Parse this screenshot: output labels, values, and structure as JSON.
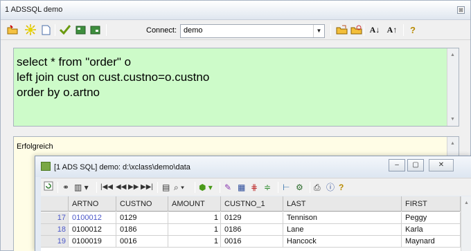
{
  "window": {
    "title": "1 ADSSQL demo",
    "close_glyph": "⊠"
  },
  "toolbar": {
    "icons": [
      "open-folder-icon",
      "execute-star-icon",
      "new-document-icon",
      "commit-check-icon",
      "grid-view-icon",
      "grid-view-2-icon"
    ],
    "connect_label": "Connect:",
    "connection_value": "demo",
    "right_icons": [
      "open-file-icon",
      "save-file-icon",
      "sort-ascending-icon",
      "sort-descending-icon",
      "help-icon"
    ],
    "sort_asc_label": "A↓",
    "sort_desc_label": "A↑"
  },
  "sql": {
    "lines": [
      "select * from \"order\" o",
      "left join cust on cust.custno=o.custno",
      "order by o.artno"
    ]
  },
  "message": {
    "text": "Erfolgreich"
  },
  "result_window": {
    "title": "[1 ADS SQL] demo: d:\\xclass\\demo\\data",
    "minimize_glyph": "–",
    "maximize_glyph": "▢",
    "close_glyph": "✕"
  },
  "grid": {
    "columns": [
      "ARTNO",
      "CUSTNO",
      "AMOUNT",
      "CUSTNO_1",
      "LAST",
      "FIRST"
    ],
    "rows": [
      {
        "num": "17",
        "artno": "0100012",
        "custno": "0129",
        "amount": "1",
        "custno_1": "0129",
        "last": "Tennison",
        "first": "Peggy"
      },
      {
        "num": "18",
        "artno": "0100012",
        "custno": "0186",
        "amount": "1",
        "custno_1": "0186",
        "last": "Lane",
        "first": "Karla"
      },
      {
        "num": "19",
        "artno": "0100019",
        "custno": "0016",
        "amount": "1",
        "custno_1": "0016",
        "last": "Hancock",
        "first": "Maynard"
      }
    ]
  }
}
